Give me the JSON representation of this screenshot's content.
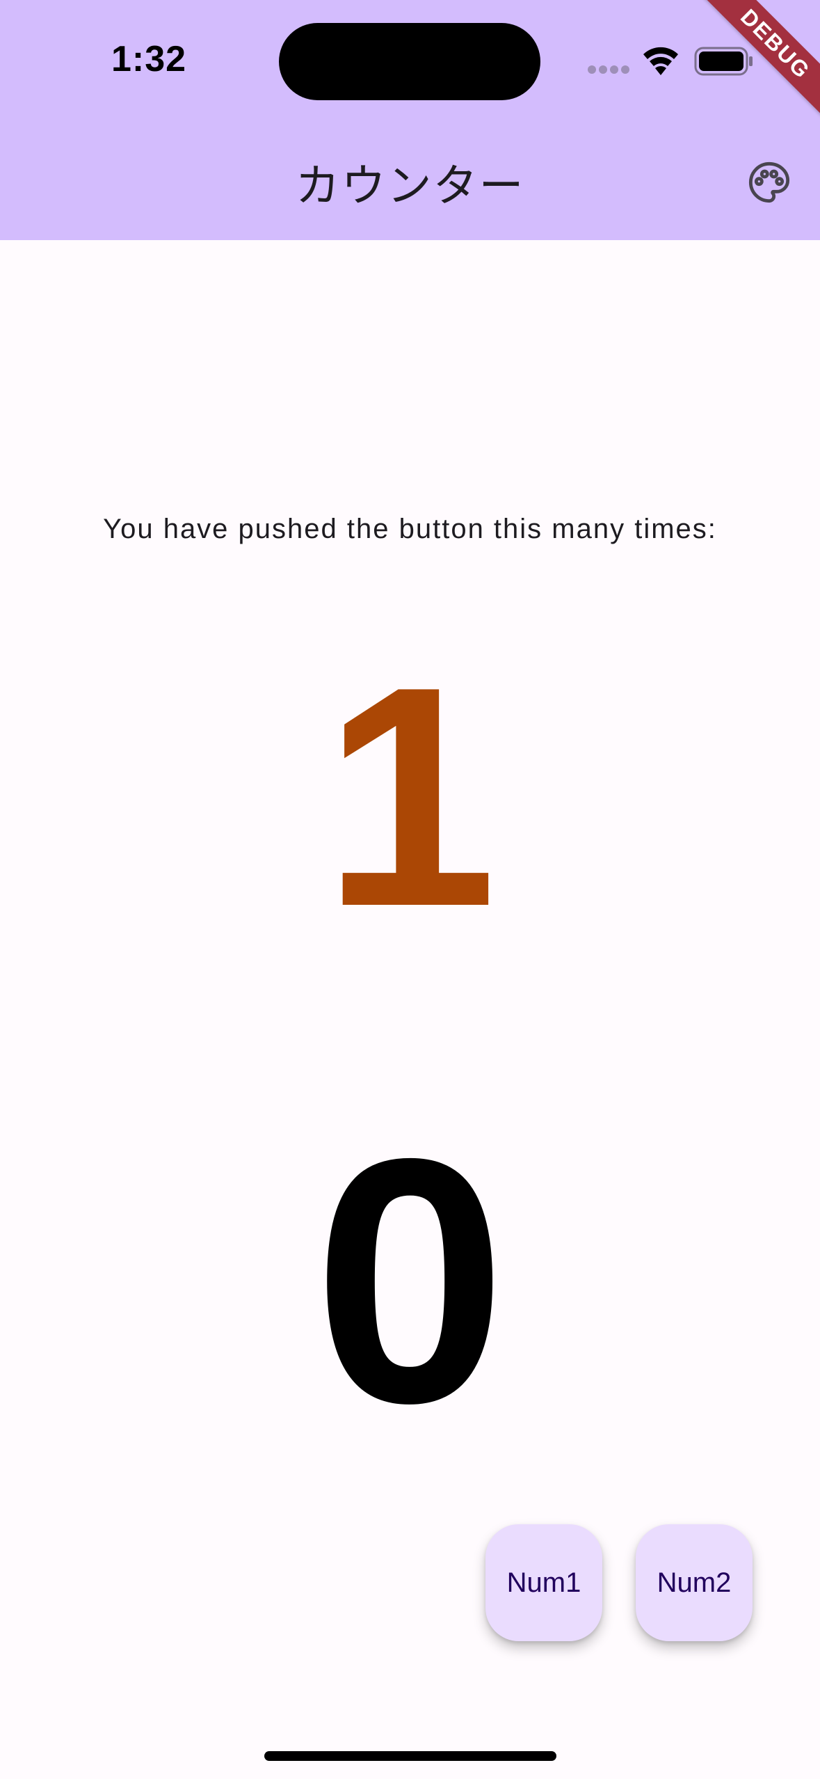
{
  "status_bar": {
    "time": "1:32",
    "icons": [
      "signal-dots-icon",
      "wifi-icon",
      "battery-icon"
    ]
  },
  "debug_banner": {
    "label": "DEBUG",
    "color": "#a3303f"
  },
  "app_bar": {
    "title": "カウンター",
    "action_icon": "palette-icon",
    "background": "#d3bcfd"
  },
  "body": {
    "prompt": "You have pushed the button this many times:",
    "counter_1": "1",
    "counter_1_color": "#ab4705",
    "counter_2": "0",
    "counter_2_color": "#000000"
  },
  "fabs": [
    {
      "label": "Num1"
    },
    {
      "label": "Num2"
    }
  ],
  "colors": {
    "background": "#fffbfe",
    "fab_background": "#eadcfe",
    "fab_text": "#21005d"
  }
}
